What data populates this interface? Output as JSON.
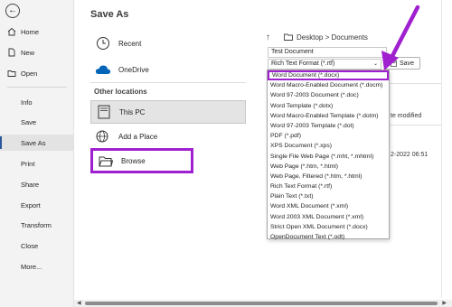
{
  "sidebar": {
    "items": [
      {
        "label": "Home"
      },
      {
        "label": "New"
      },
      {
        "label": "Open"
      },
      {
        "label": "Info"
      },
      {
        "label": "Save"
      },
      {
        "label": "Save As"
      },
      {
        "label": "Print"
      },
      {
        "label": "Share"
      },
      {
        "label": "Export"
      },
      {
        "label": "Transform"
      },
      {
        "label": "Close"
      },
      {
        "label": "More..."
      }
    ]
  },
  "main": {
    "title": "Save As",
    "locations": {
      "recent": "Recent",
      "onedrive": "OneDrive",
      "other_header": "Other locations",
      "this_pc": "This PC",
      "add_place": "Add a Place",
      "browse": "Browse"
    },
    "path": "Desktop > Documents",
    "file_name": "Test Document",
    "file_type": "Rich Text Format (*.rtf)",
    "save_label": "Save",
    "column_modified": "te modified",
    "row_date": "2-2022 06:51"
  },
  "dropdown": {
    "options": [
      "Word Document (*.docx)",
      "Word Macro-Enabled Document (*.docm)",
      "Word 97-2003 Document (*.doc)",
      "Word Template (*.dotx)",
      "Word Macro-Enabled Template (*.dotm)",
      "Word 97-2003 Template (*.dot)",
      "PDF (*.pdf)",
      "XPS Document (*.xps)",
      "Single File Web Page (*.mht, *.mhtml)",
      "Web Page (*.htm, *.html)",
      "Web Page, Filtered (*.htm, *.html)",
      "Rich Text Format (*.rtf)",
      "Plain Text (*.txt)",
      "Word XML Document (*.xml)",
      "Word 2003 XML Document (*.xml)",
      "Strict Open XML Document (*.docx)",
      "OpenDocument Text (*.odt)"
    ]
  },
  "colors": {
    "highlight": "#a020d0",
    "accent": "#2b579a",
    "onedrive": "#0364b8"
  }
}
